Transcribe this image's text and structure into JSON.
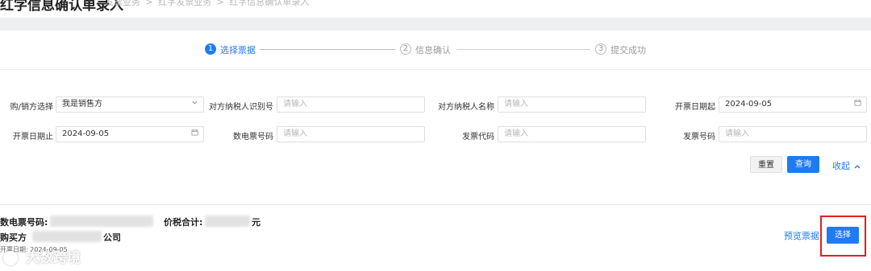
{
  "header": {
    "title": "红字信息确认单录入",
    "breadcrumb": [
      "发票业务",
      "红字发票业务",
      "红字信息确认单录入"
    ],
    "breadcrumb_sep": ">"
  },
  "steps": [
    {
      "num": "1",
      "label": "选择票据"
    },
    {
      "num": "2",
      "label": "信息确认"
    },
    {
      "num": "3",
      "label": "提交成功"
    }
  ],
  "form": {
    "buyer_seller": {
      "label": "购/销方选择",
      "value": "我是销售方"
    },
    "counterparty_tax_id": {
      "label": "对方纳税人识别号",
      "placeholder": "请输入"
    },
    "counterparty_name": {
      "label": "对方纳税人名称",
      "placeholder": "请输入"
    },
    "issue_date_start": {
      "label": "开票日期起",
      "value": "2024-09-05"
    },
    "issue_date_end": {
      "label": "开票日期止",
      "value": "2024-09-05"
    },
    "e_invoice_no": {
      "label": "数电票号码",
      "placeholder": "请输入"
    },
    "invoice_code": {
      "label": "发票代码",
      "placeholder": "请输入"
    },
    "invoice_no": {
      "label": "发票号码",
      "placeholder": "请输入"
    }
  },
  "actions": {
    "reset": "重置",
    "query": "查询",
    "collapse": "收起"
  },
  "result": {
    "e_invoice_label": "数电票号码:",
    "total_label": "价税合计:",
    "total_suffix": "元",
    "buyer_label": "购买方",
    "buyer_suffix": "公司",
    "date_prefix": "开票日期",
    "date_value": "2024-09-05",
    "preview_link": "预览票据",
    "select_button": "选择"
  },
  "watermark": "大数跨境",
  "colors": {
    "accent": "#1e7bf2",
    "highlight": "#e02020"
  }
}
